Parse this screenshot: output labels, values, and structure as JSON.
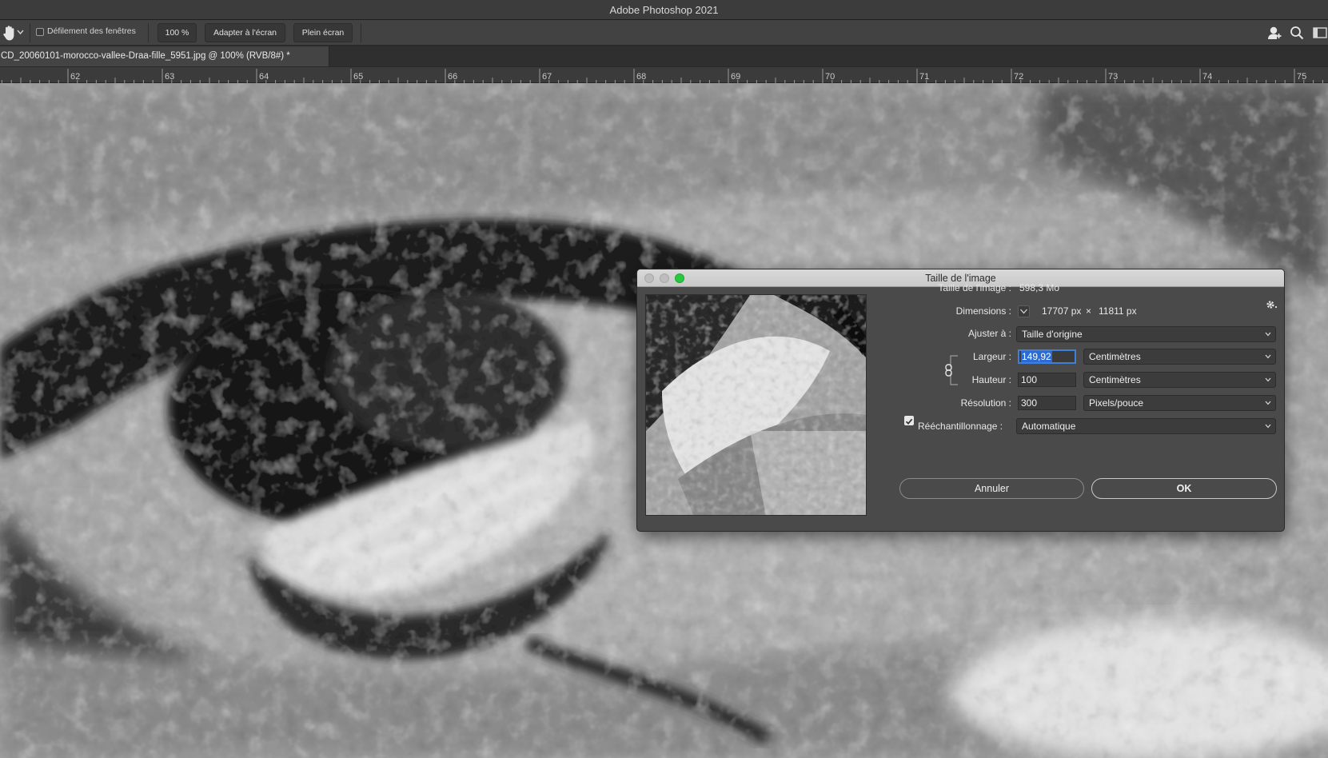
{
  "app": {
    "title": "Adobe Photoshop 2021"
  },
  "options_bar": {
    "tool_icon": "hand-tool-icon",
    "scroll_all_windows_label": "Défilement des fenêtres",
    "scroll_all_windows_checked": false,
    "zoom_100_label": "100 %",
    "fit_screen_label": "Adapter à l'écran",
    "fill_screen_label": "Plein écran",
    "right_icons": [
      "share-user-icon",
      "search-icon",
      "workspace-panel-icon"
    ]
  },
  "document_tab": {
    "label": "CD_20060101-morocco-vallee-Draa-fille_5951.jpg @ 100% (RVB/8#) *"
  },
  "ruler": {
    "ticks": [
      "62",
      "63",
      "64",
      "65",
      "66",
      "67",
      "68",
      "69",
      "70",
      "71",
      "72",
      "73",
      "74",
      "75"
    ]
  },
  "dialog": {
    "title": "Taille de l'image",
    "image_size_label": "Taille de l'image :",
    "image_size_value": "598,3 Mo",
    "dimensions_label": "Dimensions :",
    "dimensions_width": "17707 px",
    "dimensions_sep": "×",
    "dimensions_height": "11811 px",
    "fit_to_label": "Ajuster à :",
    "fit_to_value": "Taille d'origine",
    "width_label": "Largeur :",
    "width_value": "149,92",
    "width_unit": "Centimètres",
    "height_label": "Hauteur :",
    "height_value": "100",
    "height_unit": "Centimètres",
    "resolution_label": "Résolution :",
    "resolution_value": "300",
    "resolution_unit": "Pixels/pouce",
    "resample_label": "Rééchantillonnage :",
    "resample_checked": true,
    "resample_value": "Automatique",
    "cancel_label": "Annuler",
    "ok_label": "OK"
  },
  "colors": {
    "accent_blue": "#2b6bd6",
    "zoom_green": "#2ac840",
    "dialog_bg": "#4a4a4a"
  }
}
